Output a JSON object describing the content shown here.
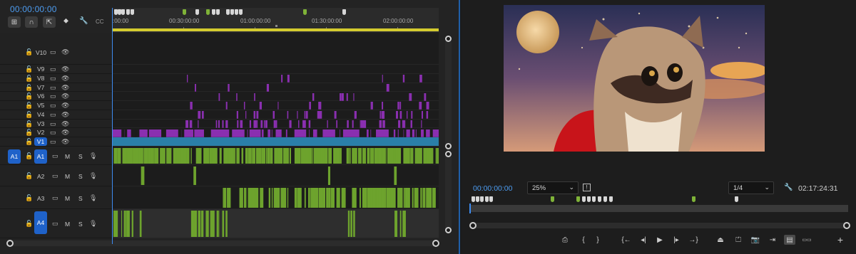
{
  "timeline": {
    "timecode": "00:00:00:00",
    "toolbar": [
      {
        "name": "insert-sequence-icon",
        "glyph": "⊞"
      },
      {
        "name": "snap-magnet-icon",
        "glyph": "∩"
      },
      {
        "name": "linked-selection-icon",
        "glyph": "⇱"
      },
      {
        "name": "add-marker-icon",
        "glyph": "⬥"
      },
      {
        "name": "settings-wrench-icon",
        "glyph": "🔧"
      },
      {
        "name": "captions-icon",
        "glyph": "CC"
      }
    ],
    "ruler_labels": [
      ":00:00",
      "00:30:00:00",
      "01:00:00:00",
      "01:30:00:00",
      "02:00:00:00"
    ],
    "video_tracks": [
      {
        "name": "V10",
        "lock": "🔓",
        "sync": "▭",
        "eye": "👁"
      },
      {
        "name": "V9",
        "lock": "🔓",
        "sync": "▭",
        "eye": "👁"
      },
      {
        "name": "V8",
        "lock": "🔓",
        "sync": "▭",
        "eye": "👁"
      },
      {
        "name": "V7",
        "lock": "🔓",
        "sync": "▭",
        "eye": "👁"
      },
      {
        "name": "V6",
        "lock": "🔓",
        "sync": "▭",
        "eye": "👁"
      },
      {
        "name": "V5",
        "lock": "🔓",
        "sync": "▭",
        "eye": "👁"
      },
      {
        "name": "V4",
        "lock": "🔓",
        "sync": "▭",
        "eye": "👁"
      },
      {
        "name": "V3",
        "lock": "🔓",
        "sync": "▭",
        "eye": "👁"
      },
      {
        "name": "V2",
        "lock": "🔓",
        "sync": "▭",
        "eye": "👁"
      },
      {
        "name": "V1",
        "lock": "🔓",
        "sync": "▭",
        "eye": "👁"
      }
    ],
    "audio_tracks": [
      {
        "name": "A1",
        "source": "A1",
        "mute": "M",
        "solo": "S"
      },
      {
        "name": "A2",
        "source": "",
        "mute": "M",
        "solo": "S"
      },
      {
        "name": "A3",
        "source": "",
        "mute": "M",
        "solo": "S"
      },
      {
        "name": "A4",
        "source": "",
        "mute": "M",
        "solo": "S"
      }
    ],
    "colors": {
      "video_v1": "#2a7fa8",
      "video_v2": "#8a2fb0",
      "audio": "#6da32d",
      "playhead": "#3d8bf0",
      "work_area": "#d4cb2e"
    }
  },
  "monitor": {
    "timecode": "00:00:00:00",
    "zoom": "25%",
    "resolution": "1/4",
    "duration": "02:17:24:31",
    "transport": [
      {
        "name": "export-frame-icon",
        "glyph": "⎙"
      },
      {
        "name": "mark-in-icon",
        "glyph": "{"
      },
      {
        "name": "mark-out-icon",
        "glyph": "}"
      },
      {
        "name": "go-to-in-icon",
        "glyph": "{←"
      },
      {
        "name": "step-back-icon",
        "glyph": "◂|"
      },
      {
        "name": "play-icon",
        "glyph": "▶"
      },
      {
        "name": "step-forward-icon",
        "glyph": "|▸"
      },
      {
        "name": "go-to-out-icon",
        "glyph": "→}"
      },
      {
        "name": "lift-icon",
        "glyph": "⏏"
      },
      {
        "name": "extract-icon",
        "glyph": "⏍"
      },
      {
        "name": "camera-icon",
        "glyph": "📷"
      },
      {
        "name": "insert-icon",
        "glyph": "⇥"
      },
      {
        "name": "overwrite-icon",
        "glyph": "▤"
      },
      {
        "name": "comparison-view-icon",
        "glyph": "▭▭"
      },
      {
        "name": "add-button-icon",
        "glyph": "+"
      }
    ]
  }
}
